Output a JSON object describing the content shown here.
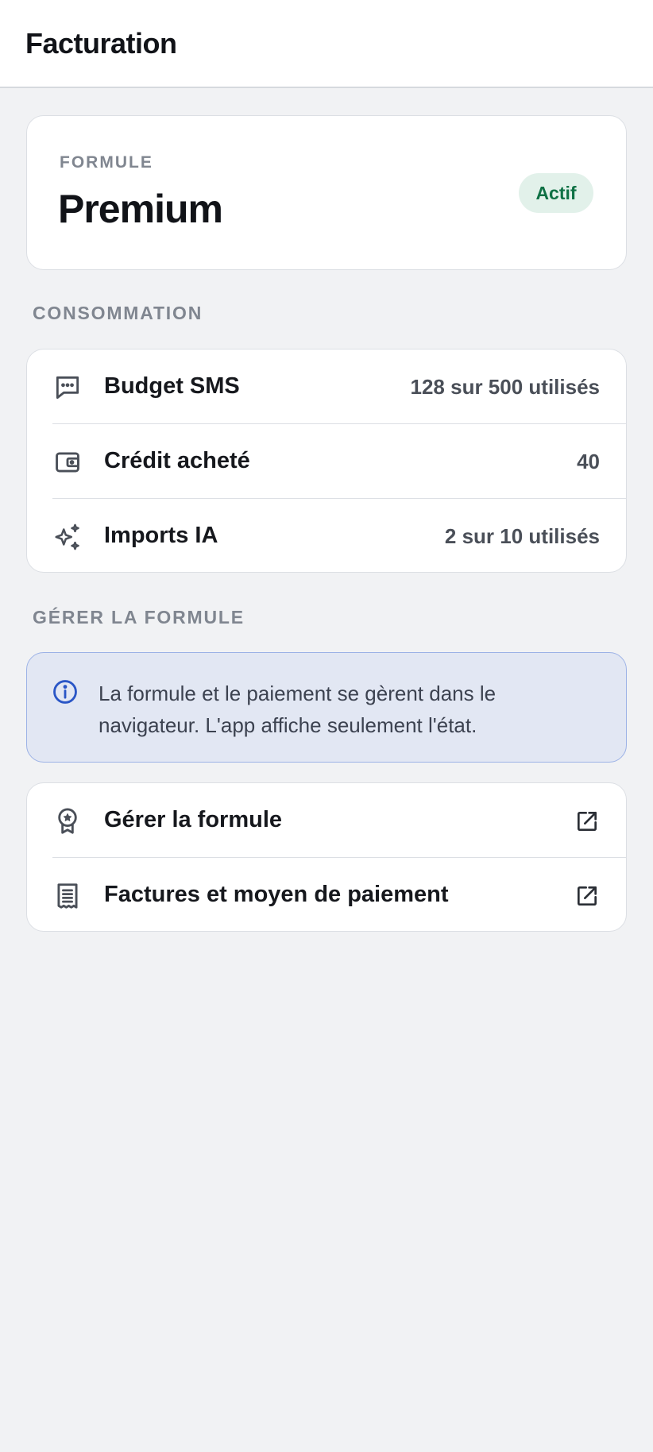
{
  "header": {
    "title": "Facturation"
  },
  "plan": {
    "eyebrow": "FORMULE",
    "name": "Premium",
    "status": "Actif"
  },
  "usage": {
    "section_label": "CONSOMMATION",
    "rows": [
      {
        "icon": "message-icon",
        "label": "Budget SMS",
        "value": "128 sur 500 utilisés"
      },
      {
        "icon": "wallet-icon",
        "label": "Crédit acheté",
        "value": "40"
      },
      {
        "icon": "sparkles-icon",
        "label": "Imports IA",
        "value": "2 sur 10 utilisés"
      }
    ]
  },
  "manage": {
    "section_label": "GÉRER LA FORMULE",
    "info": "La formule et le paiement se gèrent dans le navigateur. L'app affiche seulement l'état.",
    "items": [
      {
        "icon": "award-icon",
        "label": "Gérer la formule",
        "action_icon": "external-link-icon"
      },
      {
        "icon": "receipt-icon",
        "label": "Factures et moyen de paiement",
        "action_icon": "external-link-icon"
      }
    ]
  },
  "colors": {
    "background": "#f1f2f4",
    "card": "#ffffff",
    "badge_bg": "#e2f1ea",
    "badge_text": "#0f7145",
    "info_bg": "#e2e7f3",
    "info_border": "#9cb2e6",
    "info_icon": "#2a56c6"
  }
}
